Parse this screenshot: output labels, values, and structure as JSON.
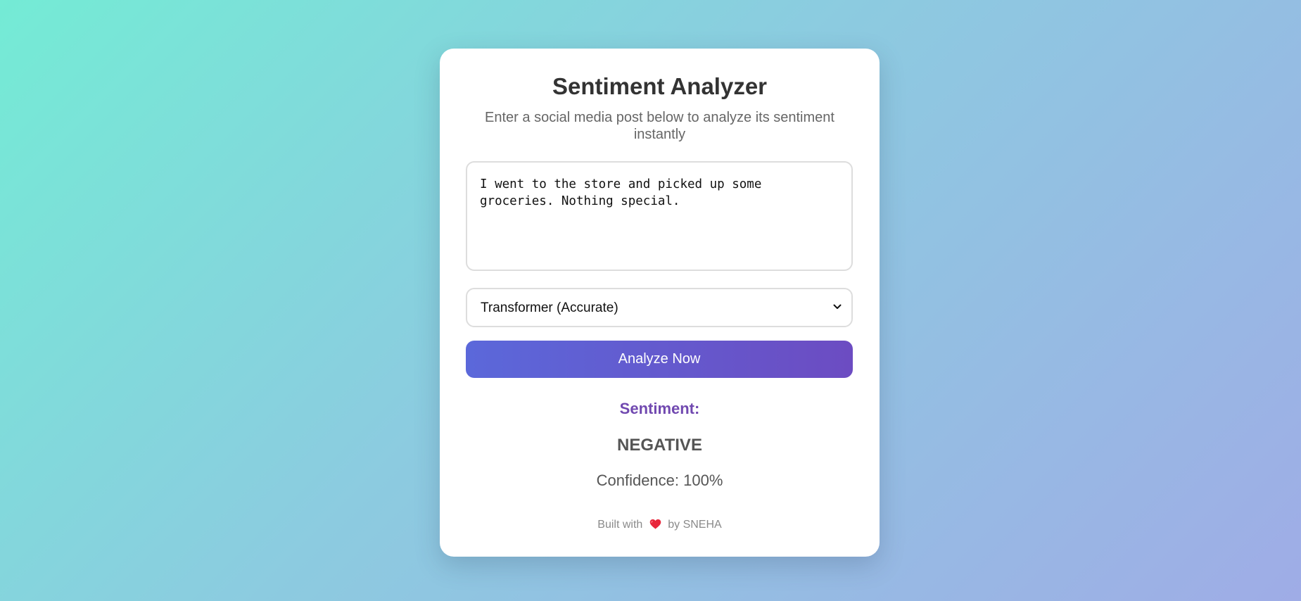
{
  "app": {
    "title": "Sentiment Analyzer",
    "subtitle": "Enter a social media post below to analyze its sentiment instantly"
  },
  "form": {
    "post_value": "I went to the store and picked up some groceries. Nothing special.",
    "model_selected": "Transformer (Accurate)",
    "analyze_label": "Analyze Now"
  },
  "result": {
    "label": "Sentiment:",
    "value": "NEGATIVE",
    "confidence": "Confidence: 100%"
  },
  "footer": {
    "prefix": "Built with",
    "heart_icon": "heart-icon",
    "suffix": "by SNEHA"
  },
  "colors": {
    "accent": "#7149b0",
    "button_start": "#5b68da",
    "button_end": "#6c4cc2",
    "heart": "#e8273c"
  }
}
